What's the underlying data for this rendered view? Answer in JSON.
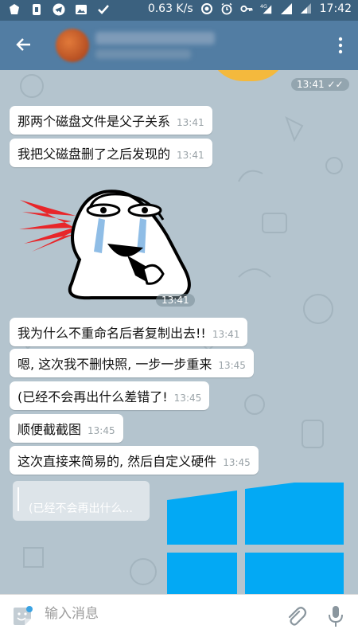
{
  "status_bar": {
    "net_speed": "0.63 K/s",
    "signal_label": "4G",
    "time": "17:42",
    "icons": [
      "notification-icon",
      "sim-icon",
      "telegram-icon",
      "gallery-icon",
      "check-icon",
      "sync-icon",
      "alarm-icon",
      "key-icon",
      "signal-icon",
      "signal-icon",
      "battery-icon"
    ]
  },
  "header": {
    "back_icon": "arrow-left-icon",
    "menu_icon": "more-vertical-icon"
  },
  "chat": {
    "top_time": "13:41",
    "messages": [
      {
        "text": "那两个磁盘文件是父子关系",
        "time": "13:41"
      },
      {
        "text": "我把父磁盘删了之后发现的",
        "time": "13:41"
      },
      {
        "text": "我为什么不重命名后者复制出去!!",
        "time": "13:41"
      },
      {
        "text": "嗯, 这次我不删快照, 一步一步重来",
        "time": "13:45"
      },
      {
        "text": "(已经不会再出什么差错了!",
        "time": "13:45"
      },
      {
        "text": "顺便截截图",
        "time": "13:45"
      },
      {
        "text": "这次直接来简易的, 然后自定义硬件",
        "time": "13:45"
      }
    ],
    "sticker_time": "13:41",
    "reply_preview": "(已经不会再出什么...",
    "colors": {
      "windows_blue": "#03a9f4",
      "bubble": "#ffffff"
    }
  },
  "composer": {
    "placeholder": "输入消息",
    "emoji_icon": "sticker-icon",
    "attach_icon": "paperclip-icon",
    "mic_icon": "microphone-icon"
  }
}
